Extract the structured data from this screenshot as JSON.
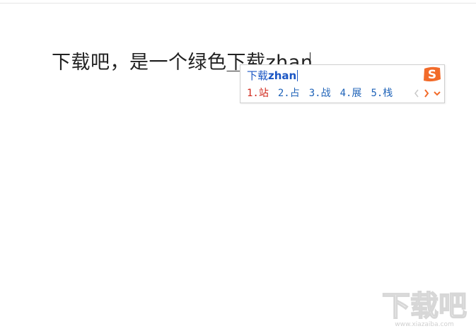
{
  "document": {
    "committed_text": "下载吧，是一个绿色",
    "composition_text": "下载zhan"
  },
  "ime": {
    "composition": {
      "hanzi": "下载",
      "pinyin": "zhan"
    },
    "candidates": [
      {
        "label": "1.站",
        "selected": true
      },
      {
        "label": "2.占",
        "selected": false
      },
      {
        "label": "3.战",
        "selected": false
      },
      {
        "label": "4.展",
        "selected": false
      },
      {
        "label": "5.栈",
        "selected": false
      }
    ],
    "logo_icon": "sogou-logo-icon",
    "colors": {
      "selected": "#d0271b",
      "candidate": "#1f63b8",
      "logo": "#f26b2a"
    }
  },
  "watermark": {
    "text": "下载吧",
    "url_text": "www.xiazaiba.com"
  }
}
